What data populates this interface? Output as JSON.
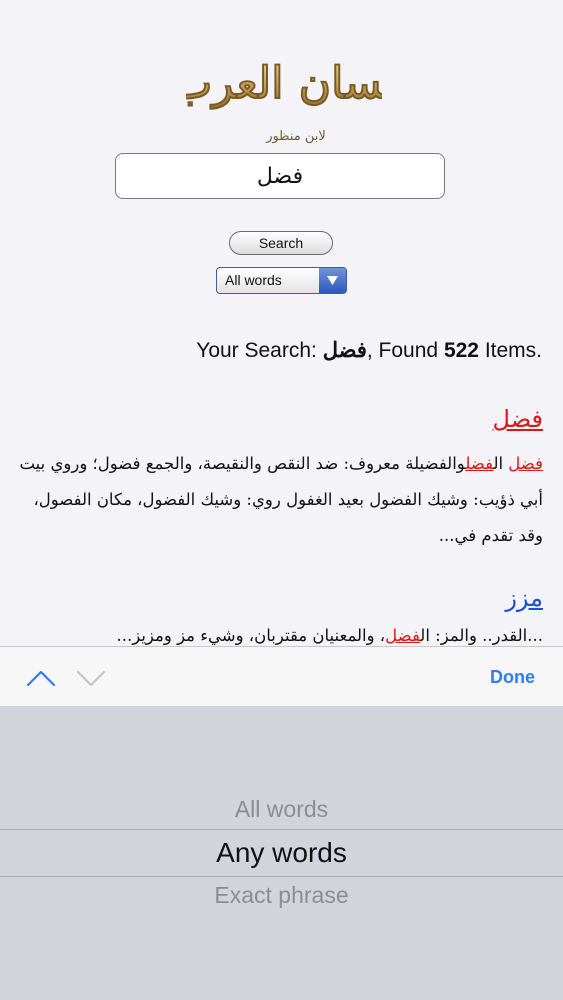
{
  "app": {
    "logo_text": "لسان العرب",
    "logo_subtitle": "لابن منظور"
  },
  "search": {
    "query": "فضل",
    "button_label": "Search",
    "mode_selected": "All words"
  },
  "results": {
    "summary_prefix": "Your Search: ",
    "summary_query": "فضل",
    "summary_mid": ", Found ",
    "summary_count": "522",
    "summary_suffix": " Items.",
    "items": [
      {
        "title": "فضل",
        "snippet_parts": [
          "",
          "فضل",
          " ال",
          "فضل",
          "والفضيلة معروف: ضد النقص والنقيصة، والجمع فضول؛ وروي بيت أبي ذؤيب: وشيك الفضول بعيد الغفول روي: وشيك الفضول، مكان الفصول، وقد تقدم في..."
        ]
      },
      {
        "title": "مزز",
        "snippet_parts": [
          "...القدر.. والمز: ال",
          "فضل",
          "، والمعنيان مقتربان، وشيء مز ومزيز..."
        ]
      }
    ]
  },
  "toolbar": {
    "done_label": "Done"
  },
  "picker": {
    "options": [
      "All words",
      "Any words",
      "Exact phrase"
    ],
    "selected": "Any words"
  },
  "colors": {
    "highlight": "#d81818",
    "link_blue": "#1b4fd6",
    "done_blue": "#2f7cf6"
  }
}
